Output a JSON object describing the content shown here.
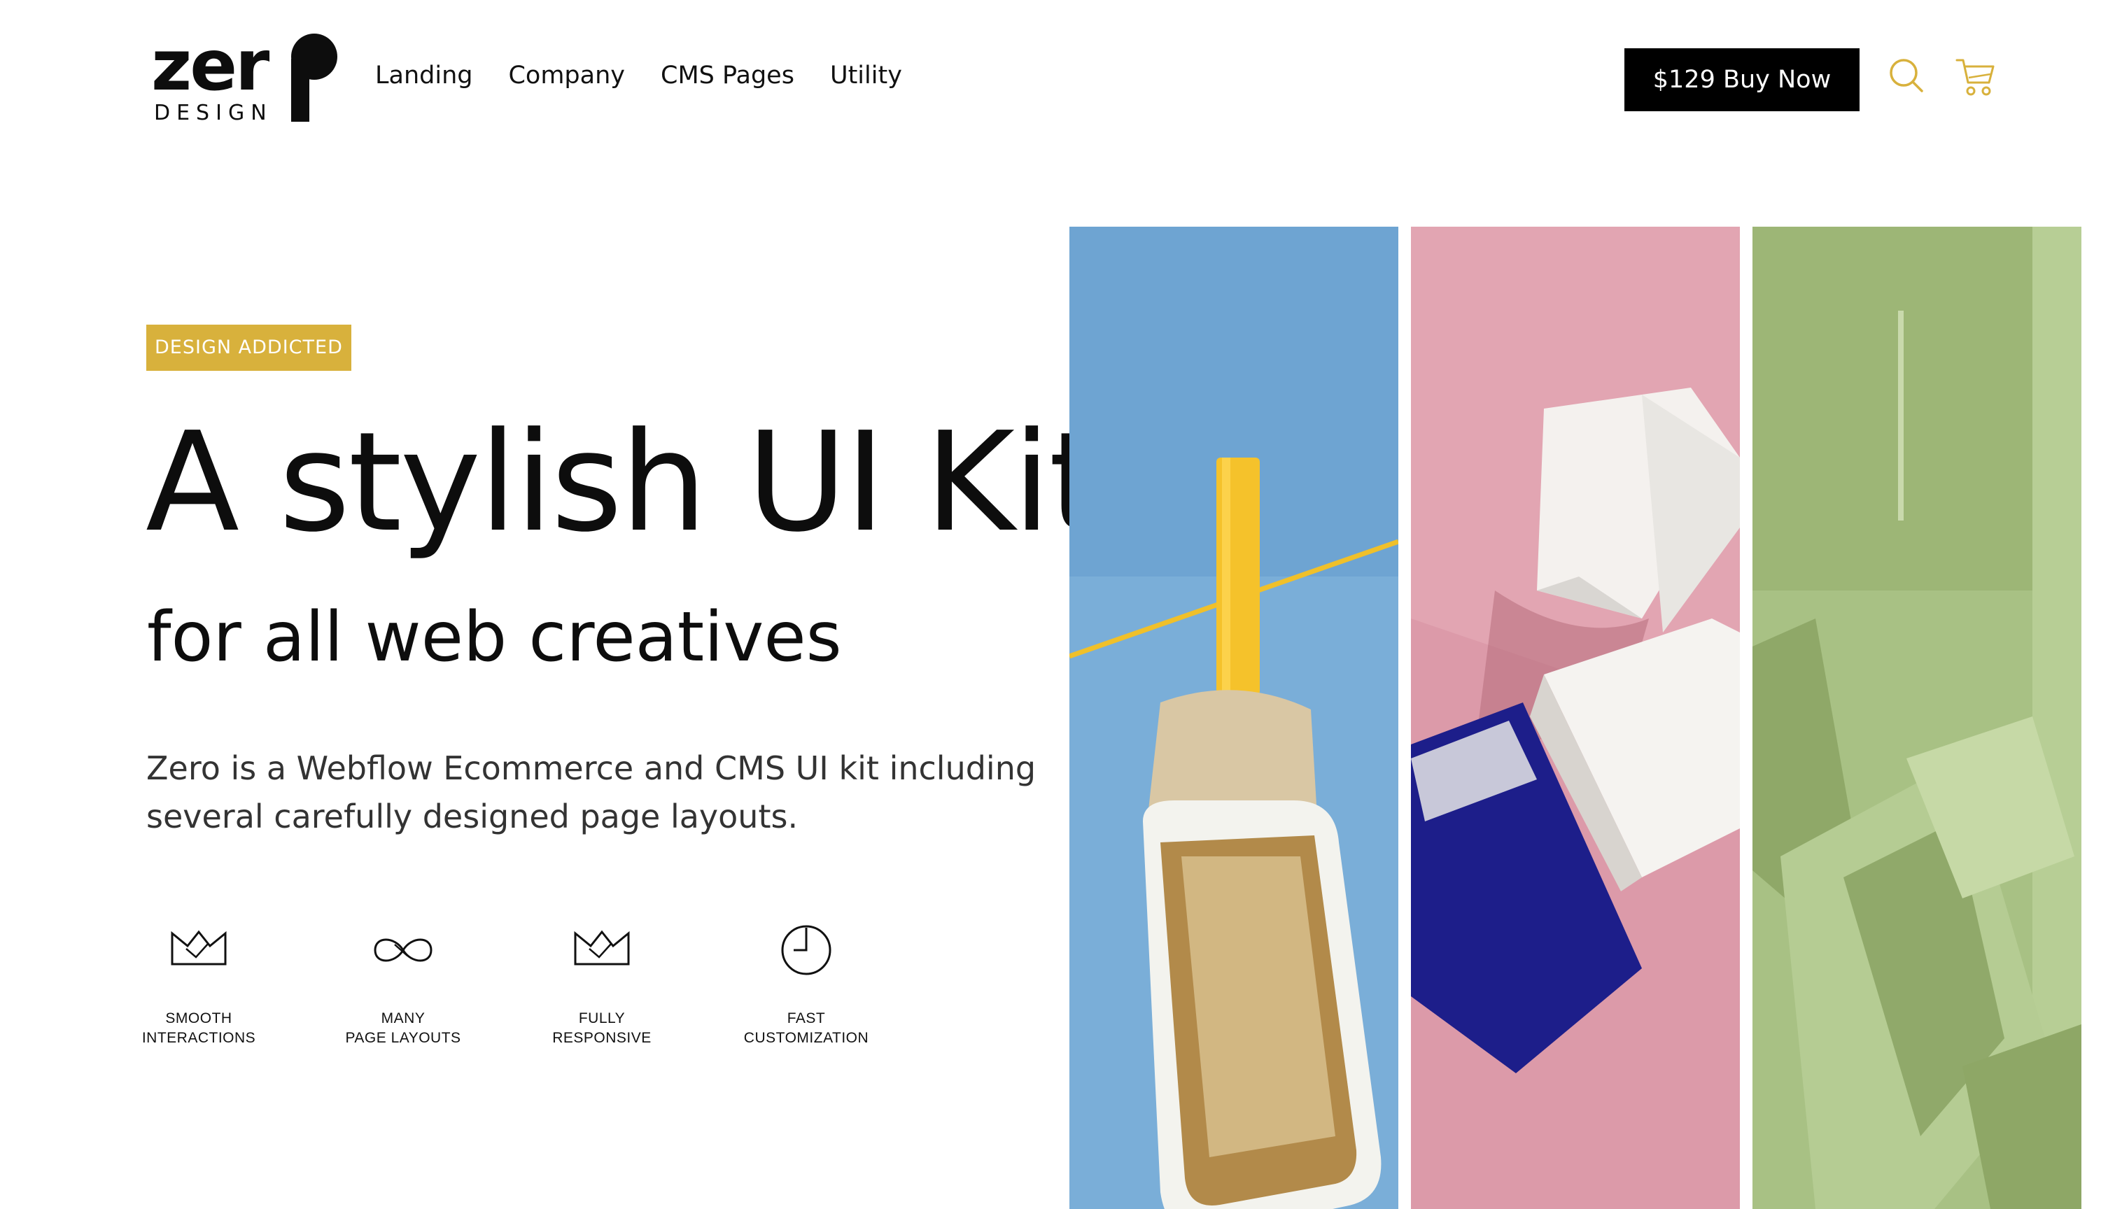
{
  "brand": {
    "wordmark": "zer",
    "sub": "DESIGN"
  },
  "nav": {
    "items": [
      "Landing",
      "Company",
      "CMS Pages",
      "Utility"
    ]
  },
  "header": {
    "buy_label": "$129 Buy Now",
    "accent_color": "#d8b13c"
  },
  "hero": {
    "tag": "DESIGN ADDICTED",
    "title": "A stylish UI Kit",
    "subtitle": "for all web creatives",
    "description": "Zero is a Webflow Ecommerce and CMS UI kit including several carefully designed page layouts."
  },
  "features": [
    {
      "icon": "crown-icon",
      "label": "SMOOTH\nINTERACTIONS"
    },
    {
      "icon": "infinity-icon",
      "label": "MANY\nPAGE LAYOUTS"
    },
    {
      "icon": "crown-icon",
      "label": "FULLY\nRESPONSIVE"
    },
    {
      "icon": "clock-icon",
      "label": "FAST\nCUSTOMIZATION"
    }
  ],
  "panels": [
    {
      "name": "clothespin-tin-image",
      "background": "#7aaed8"
    },
    {
      "name": "paper-planes-book-image",
      "background": "#e2a5b2"
    },
    {
      "name": "green-paper-shapes-image",
      "background": "#a8c184"
    }
  ]
}
